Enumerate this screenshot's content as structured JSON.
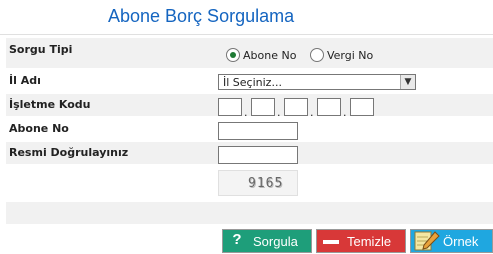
{
  "page": {
    "title": "Abone Borç Sorgulama"
  },
  "form": {
    "sorgu_tipi": {
      "label": "Sorgu Tipi",
      "options": [
        "Abone No",
        "Vergi No"
      ],
      "selected": "Abone No"
    },
    "il_adi": {
      "label": "İl Adı",
      "value": "İl Seçiniz..."
    },
    "isletme_kodu": {
      "label": "İşletme Kodu",
      "dots": [
        ".",
        " .",
        " .",
        " ."
      ]
    },
    "abone_no": {
      "label": "Abone No",
      "value": ""
    },
    "resmi_dogrula": {
      "label": "Resmi Doğrulayınız",
      "value": ""
    },
    "captcha": {
      "text": "9165"
    }
  },
  "buttons": {
    "sorgula": "Sorgula",
    "temizle": "Temizle",
    "ornek": "Örnek"
  },
  "icons": {
    "sorgula": "question-icon",
    "temizle": "minus-icon",
    "ornek": "note-pencil-icon"
  },
  "colors": {
    "title": "#1565c0",
    "sorgula": "#1e9e7a",
    "temizle": "#d83838",
    "ornek": "#1fa7e0"
  }
}
